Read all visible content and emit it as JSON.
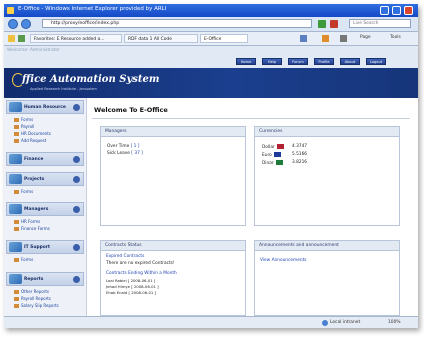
{
  "window": {
    "title": "E-Office - Windows Internet Explorer provided by ARLI"
  },
  "address_bar": {
    "url": "http://proxy/eoffice/index.php",
    "search_placeholder": "Live Search"
  },
  "tabs": [
    {
      "label": "Favorites: E Resource added a..."
    },
    {
      "label": "RDF data 1 All Code"
    },
    {
      "label": "E-Office"
    }
  ],
  "toolbar_right": {
    "page": "Page",
    "tools": "Tools"
  },
  "page": {
    "top_welcome": "Welcome: Administrator",
    "nav_buttons": [
      "Home",
      "Help",
      "Forum",
      "Profile",
      "About",
      "Logout"
    ],
    "banner_title": "ffice Automation System",
    "banner_subtitle": "Applied Research Institute - Jerusalem",
    "welcome_heading": "Welcome To E-Office"
  },
  "sidebar": {
    "sections": [
      {
        "title": "Human Resource",
        "items": [
          "Forms",
          "Payroll",
          "HR Documents",
          "Add Request"
        ]
      },
      {
        "title": "Finance",
        "items": []
      },
      {
        "title": "Projects",
        "items": [
          "Forms"
        ]
      },
      {
        "title": "Managers",
        "items": [
          "HR Forms",
          "Finance Forms"
        ]
      },
      {
        "title": "IT Support",
        "items": [
          "Forms"
        ]
      },
      {
        "title": "Reports",
        "items": [
          "Other Reports",
          "Payroll Reports",
          "Salary Slip Reports"
        ]
      }
    ]
  },
  "managers": {
    "title": "Managers",
    "rows": [
      {
        "label": "Over Time",
        "count": "[ 1 ]"
      },
      {
        "label": "Sick Leave",
        "count": "[ 37 ]"
      }
    ]
  },
  "currencies": {
    "title": "Currencies",
    "rows": [
      {
        "name": "Dollar",
        "value": "4.3747",
        "flag": "#b22234"
      },
      {
        "name": "Euro",
        "value": "5.5166",
        "flag": "#1b3a9a"
      },
      {
        "name": "Dinar",
        "value": "3.8216",
        "flag": "#1e7a3a"
      }
    ]
  },
  "contracts": {
    "title": "Contracts Status",
    "expired_label": "Expired Contracts",
    "expired_msg": "There are no expired Contracts!",
    "ending_label": "Contracts Ending Within a Month",
    "ending_rows": [
      "Loai Rabiei [ 2008-06-01 ]",
      "Jehad Himye [ 2008-06-01 ]",
      "Ehab Enaid [ 2008-06-01 ]"
    ]
  },
  "announcements": {
    "title": "Announcements and announcement",
    "link": "View Announcements"
  },
  "status_bar": {
    "zone": "Local intranet",
    "zoom": "100%"
  }
}
